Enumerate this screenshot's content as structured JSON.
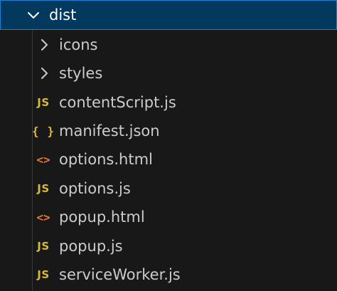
{
  "explorer": {
    "root": {
      "label": "dist",
      "expanded": true
    },
    "items": [
      {
        "type": "folder",
        "label": "icons",
        "icon": "chevron-right-icon"
      },
      {
        "type": "folder",
        "label": "styles",
        "icon": "chevron-right-icon"
      },
      {
        "type": "file",
        "label": "contentScript.js",
        "icon_text": "JS",
        "icon": "js-file-icon"
      },
      {
        "type": "file",
        "label": "manifest.json",
        "icon_text": "{ }",
        "icon": "json-file-icon"
      },
      {
        "type": "file",
        "label": "options.html",
        "icon_text": "<>",
        "icon": "html-file-icon"
      },
      {
        "type": "file",
        "label": "options.js",
        "icon_text": "JS",
        "icon": "js-file-icon"
      },
      {
        "type": "file",
        "label": "popup.html",
        "icon_text": "<>",
        "icon": "html-file-icon"
      },
      {
        "type": "file",
        "label": "popup.js",
        "icon_text": "JS",
        "icon": "js-file-icon"
      },
      {
        "type": "file",
        "label": "serviceWorker.js",
        "icon_text": "JS",
        "icon": "js-file-icon"
      }
    ]
  },
  "colors": {
    "background": "#181818",
    "selection": "#04395e",
    "focus_border": "#1e7fd4",
    "js_icon": "#d7ba3b",
    "json_icon": "#d7ba3b",
    "html_icon": "#e37933",
    "text": "#cccccc"
  }
}
